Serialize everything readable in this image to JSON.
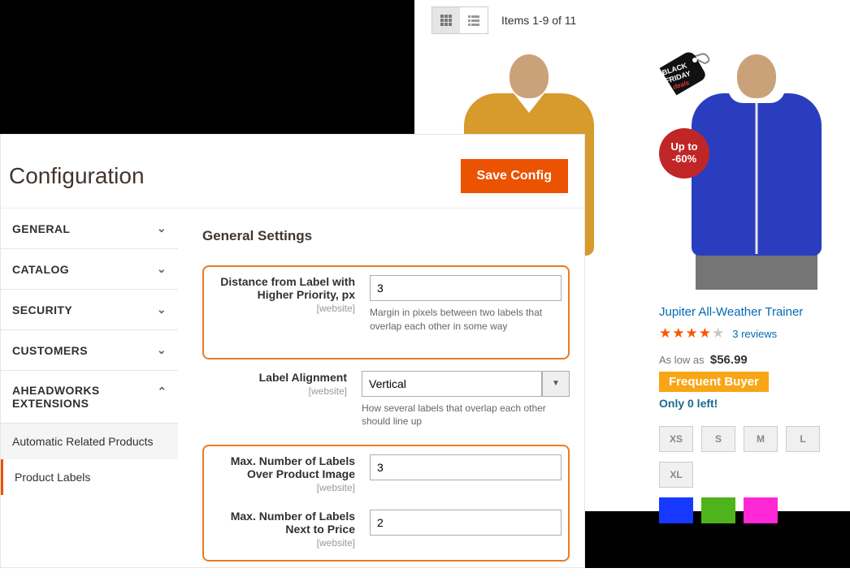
{
  "admin": {
    "title": "Configuration",
    "save_label": "Save Config",
    "sidebar": {
      "items": [
        {
          "label": "GENERAL",
          "expanded": false
        },
        {
          "label": "CATALOG",
          "expanded": false
        },
        {
          "label": "SECURITY",
          "expanded": false
        },
        {
          "label": "CUSTOMERS",
          "expanded": false
        },
        {
          "label": "AHEADWORKS EXTENSIONS",
          "expanded": true
        }
      ],
      "subitems": [
        {
          "label": "Automatic Related Products",
          "active": false
        },
        {
          "label": "Product Labels",
          "active": true
        }
      ]
    },
    "settings": {
      "heading": "General Settings",
      "scope_text": "[website]",
      "fields": {
        "distance": {
          "label": "Distance from Label with Higher Priority, px",
          "value": "3",
          "hint": "Margin in pixels between two labels that overlap each other in some way"
        },
        "alignment": {
          "label": "Label Alignment",
          "value": "Vertical",
          "hint": "How several labels that overlap each other should line up"
        },
        "max_over_image": {
          "label": "Max. Number of Labels Over Product Image",
          "value": "3"
        },
        "max_next_price": {
          "label": "Max. Number of Labels Next to Price",
          "value": "2"
        }
      }
    }
  },
  "storefront": {
    "items_text": "Items 1-9 of 11",
    "badges": {
      "tag_line1": "BLACK",
      "tag_line2": "FRIDAY",
      "tag_line3": "deals",
      "disc_line1": "Up to",
      "disc_line2": "-60%",
      "frequent": "Frequent Buyer"
    },
    "product": {
      "name": "Jupiter All-Weather Trainer",
      "reviews_count": "3 reviews",
      "rating_filled": 4,
      "aslowas": "As low as",
      "price": "$56.99",
      "stock": "Only 0 left!",
      "sizes": [
        "XS",
        "S",
        "M",
        "L",
        "XL"
      ]
    }
  }
}
